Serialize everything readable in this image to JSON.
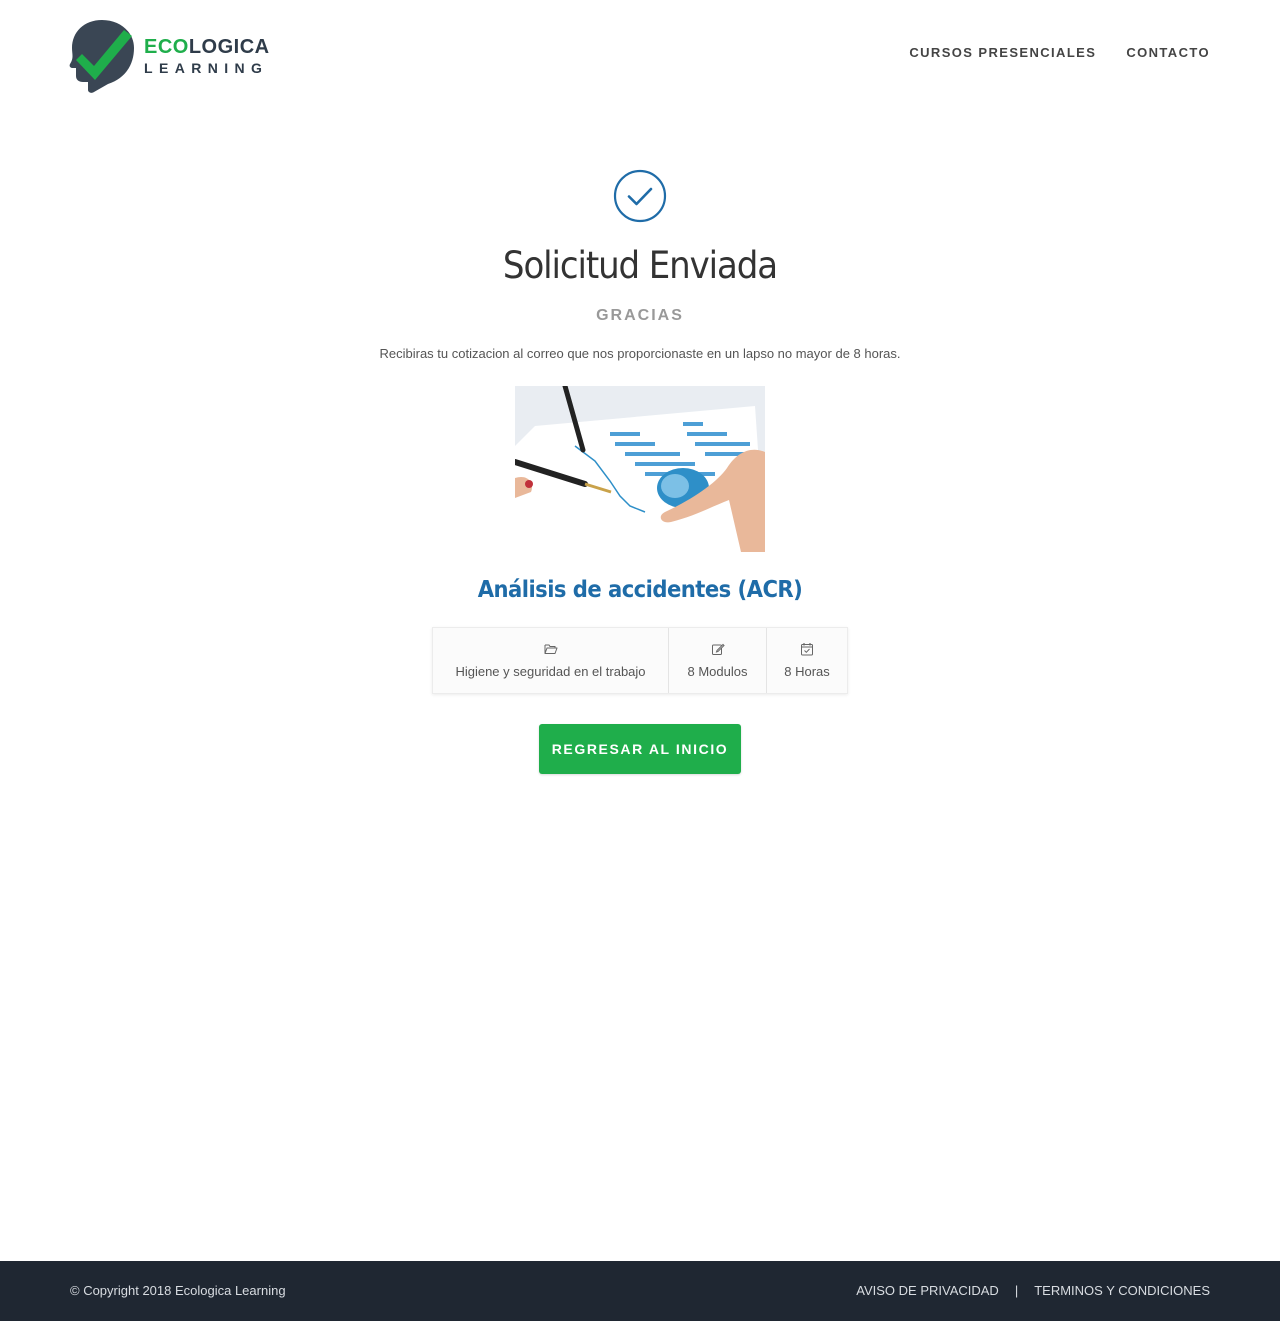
{
  "header": {
    "logo": {
      "word1_part1": "ECO",
      "word1_part2": "LOGICA",
      "word2": "LEARNING"
    },
    "nav": [
      {
        "label": "CURSOS PRESENCIALES"
      },
      {
        "label": "CONTACTO"
      }
    ]
  },
  "main": {
    "icon": "check-circle-icon",
    "title": "Solicitud Enviada",
    "subtitle": "GRACIAS",
    "message": "Recibiras tu cotizacion al correo que nos proporcionaste en un lapso no mayor de 8 horas.",
    "course": {
      "title": "Análisis de accidentes (ACR)",
      "category": {
        "icon": "folder-open-icon",
        "label": "Higiene y seguridad en el trabajo"
      },
      "modules": {
        "icon": "edit-icon",
        "label": "8 Modulos"
      },
      "hours": {
        "icon": "calendar-check-icon",
        "label": "8 Horas"
      }
    },
    "back_button": "REGRESAR AL INICIO"
  },
  "footer": {
    "copyright": "© Copyright 2018 Ecologica Learning",
    "links": [
      {
        "label": "AVISO DE PRIVACIDAD"
      },
      {
        "label": "TERMINOS Y CONDICIONES"
      }
    ],
    "separator": "|"
  },
  "colors": {
    "brand_green": "#1fae4b",
    "brand_dark": "#2f3c4a",
    "accent_blue": "#1f6ca8",
    "footer_bg": "#1f2732"
  }
}
